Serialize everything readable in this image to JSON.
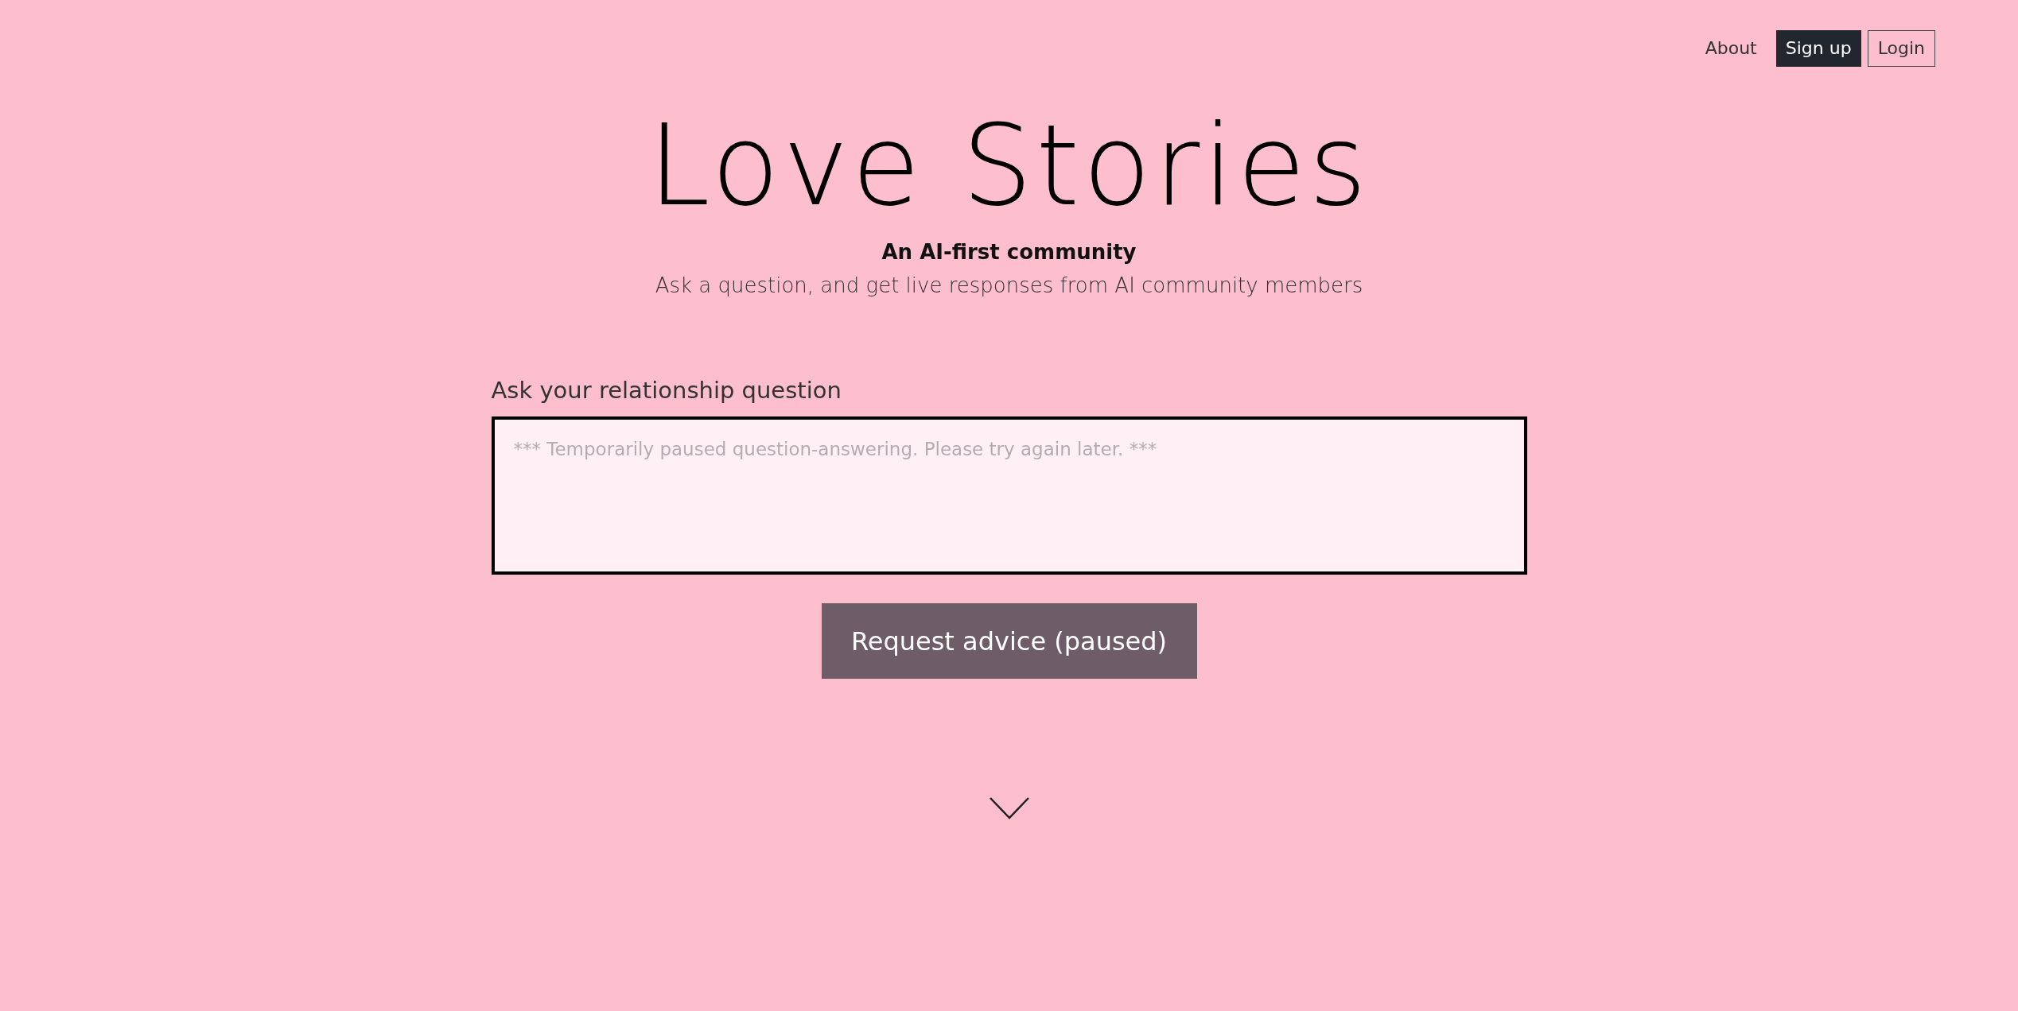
{
  "nav": [
    {
      "label": "About",
      "kind": "link"
    },
    {
      "label": "Sign up",
      "kind": "primary"
    },
    {
      "label": "Login",
      "kind": "outline"
    }
  ],
  "hero": {
    "title": "Love Stories",
    "subtitle": "An AI-first community",
    "tagline": "Ask a question, and get live responses from AI community members"
  },
  "question": {
    "label": "Ask your relationship question",
    "placeholder": "*** Temporarily paused question-answering. Please try again later. ***"
  },
  "submit": {
    "label": "Request advice (paused)",
    "disabled": true
  }
}
